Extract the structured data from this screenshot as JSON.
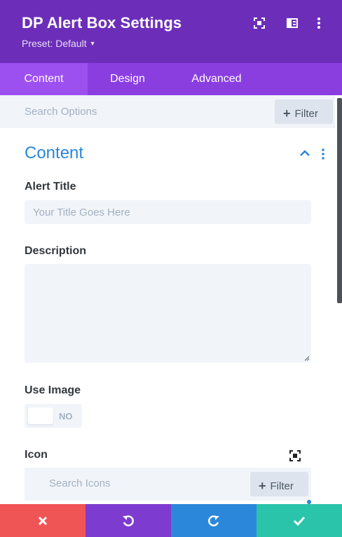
{
  "header": {
    "title": "DP Alert Box Settings",
    "preset_label": "Preset: Default",
    "icons": [
      "expand-icon",
      "sidebar-toggle-icon",
      "kebab-menu-icon"
    ],
    "bg_color": "#6c2eb9"
  },
  "tabs": [
    {
      "label": "Content",
      "active": true
    },
    {
      "label": "Design",
      "active": false
    },
    {
      "label": "Advanced",
      "active": false
    }
  ],
  "search": {
    "placeholder": "Search Options",
    "filter_label": "Filter"
  },
  "section": {
    "title": "Content",
    "accent_color": "#2b87da"
  },
  "fields": {
    "alert_title": {
      "label": "Alert Title",
      "placeholder": "Your Title Goes Here",
      "value": ""
    },
    "description": {
      "label": "Description",
      "value": ""
    },
    "use_image": {
      "label": "Use Image",
      "toggle_text": "NO",
      "value": false
    },
    "icon": {
      "label": "Icon",
      "search_placeholder": "Search Icons",
      "filter_label": "Filter"
    }
  },
  "bottom_bar": [
    {
      "name": "cancel",
      "icon": "close-icon",
      "color": "#ef5555"
    },
    {
      "name": "undo",
      "icon": "undo-icon",
      "color": "#7e3bd0"
    },
    {
      "name": "redo",
      "icon": "redo-icon",
      "color": "#2b87da"
    },
    {
      "name": "save",
      "icon": "check-icon",
      "color": "#29c4a9"
    }
  ]
}
